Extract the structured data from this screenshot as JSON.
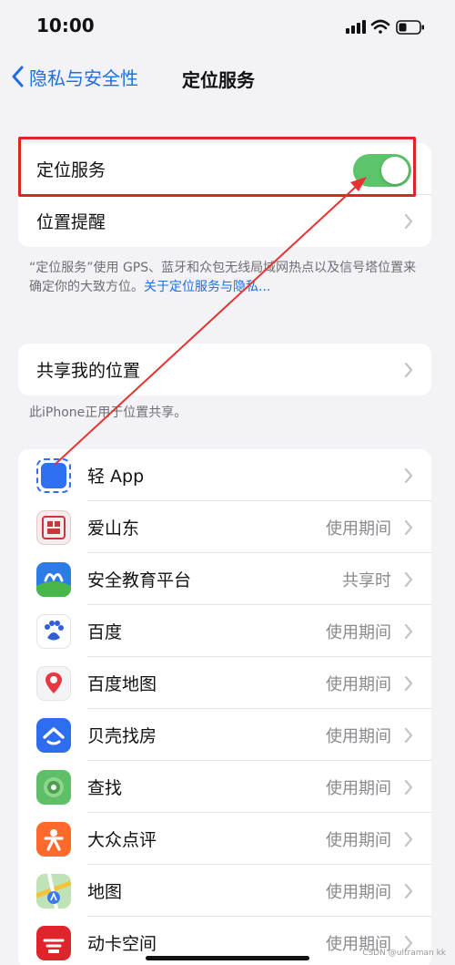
{
  "status_bar": {
    "time": "10:00"
  },
  "nav": {
    "back_label": "隐私与安全性",
    "title": "定位服务"
  },
  "location_section": {
    "toggle_label": "定位服务",
    "toggle_on": true,
    "reminder_label": "位置提醒"
  },
  "location_footnote": {
    "text": "“定位服务”使用 GPS、蓝牙和众包无线局域网热点以及信号塔位置来确定你的大致方位。",
    "link": "关于定位服务与隐私..."
  },
  "share_section": {
    "label": "共享我的位置"
  },
  "share_footnote": "此iPhone正用于位置共享。",
  "apps": [
    {
      "name": "轻 App",
      "value": "",
      "icon": "light-app-icon"
    },
    {
      "name": "爱山东",
      "value": "使用期间",
      "icon": "aishandong-icon"
    },
    {
      "name": "安全教育平台",
      "value": "共享时",
      "icon": "safety-education-icon"
    },
    {
      "name": "百度",
      "value": "使用期间",
      "icon": "baidu-icon"
    },
    {
      "name": "百度地图",
      "value": "使用期间",
      "icon": "baidu-maps-icon"
    },
    {
      "name": "贝壳找房",
      "value": "使用期间",
      "icon": "beike-icon"
    },
    {
      "name": "查找",
      "value": "使用期间",
      "icon": "find-my-icon"
    },
    {
      "name": "大众点评",
      "value": "使用期间",
      "icon": "dianping-icon"
    },
    {
      "name": "地图",
      "value": "使用期间",
      "icon": "maps-icon"
    },
    {
      "name": "动卡空间",
      "value": "使用期间",
      "icon": "dongka-icon"
    }
  ],
  "watermark": "CSDN @ultraman kk",
  "colors": {
    "accent": "#1f6fe0",
    "toggle_on": "#5cc46a",
    "highlight": "#e02424"
  }
}
